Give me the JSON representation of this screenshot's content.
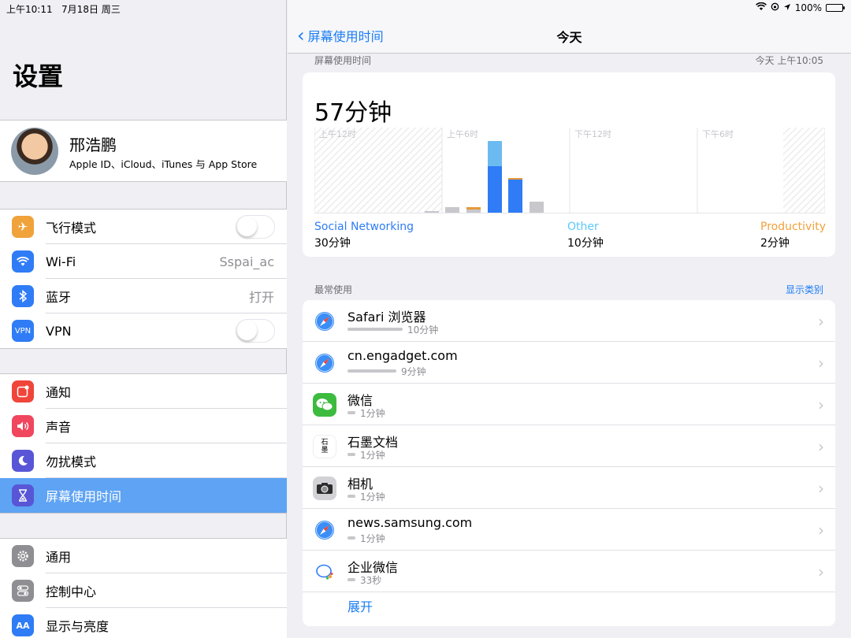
{
  "status_bar": {
    "time": "上午10:11",
    "date": "7月18日 周三",
    "battery": "100%"
  },
  "sidebar": {
    "title": "设置",
    "profile": {
      "name": "邢浩鹏",
      "subtitle": "Apple ID、iCloud、iTunes 与 App Store"
    },
    "group1": [
      {
        "label": "飞行模式",
        "icon": "airplane-icon",
        "color": "#f0a23b",
        "toggle": false
      },
      {
        "label": "Wi-Fi",
        "icon": "wifi-icon",
        "color": "#2f7cf6",
        "value": "Sspai_ac"
      },
      {
        "label": "蓝牙",
        "icon": "bluetooth-icon",
        "color": "#2f7cf6",
        "value": "打开"
      },
      {
        "label": "VPN",
        "icon": "vpn-icon",
        "color": "#2f7cf6",
        "toggle": false
      }
    ],
    "group2": [
      {
        "label": "通知",
        "icon": "notifications-icon",
        "color": "#f0453a"
      },
      {
        "label": "声音",
        "icon": "speaker-icon",
        "color": "#f0465e"
      },
      {
        "label": "勿扰模式",
        "icon": "moon-icon",
        "color": "#5856d6"
      },
      {
        "label": "屏幕使用时间",
        "icon": "hourglass-icon",
        "color": "#5856d6",
        "selected": true
      }
    ],
    "group3": [
      {
        "label": "通用",
        "icon": "gear-icon",
        "color": "#8e8e93"
      },
      {
        "label": "控制中心",
        "icon": "switches-icon",
        "color": "#8e8e93"
      },
      {
        "label": "显示与亮度",
        "icon": "display-icon",
        "color": "#2f7cf6"
      }
    ]
  },
  "nav": {
    "back_label": "屏幕使用时间",
    "title": "今天"
  },
  "screen_time": {
    "header": "屏幕使用时间",
    "updated": "今天 上午10:05",
    "total": "57分钟",
    "chart_ticks": [
      "上午12时",
      "上午6时",
      "下午12时",
      "下午6时"
    ],
    "categories": [
      {
        "name": "Social Networking",
        "time": "30分钟",
        "color": "#2f7cf6"
      },
      {
        "name": "Other",
        "time": "10分钟",
        "color": "#5ac8fa"
      },
      {
        "name": "Productivity",
        "time": "2分钟",
        "color": "#f0a23b"
      }
    ],
    "colors": {
      "social": "#2f7cf6",
      "other": "#6cbbf0",
      "productivity": "#e69a3a",
      "misc": "#c7c7cc"
    }
  },
  "most_used": {
    "header": "最常使用",
    "show_categories": "显示类别",
    "apps": [
      {
        "name": "Safari 浏览器",
        "duration": "10分钟",
        "icon": "safari-icon",
        "fraction": 1.0
      },
      {
        "name": "cn.engadget.com",
        "duration": "9分钟",
        "icon": "safari-icon",
        "fraction": 0.9
      },
      {
        "name": "微信",
        "duration": "1分钟",
        "icon": "wechat-icon",
        "fraction": 0.1
      },
      {
        "name": "石墨文档",
        "duration": "1分钟",
        "icon": "shimo-icon",
        "fraction": 0.1
      },
      {
        "name": "相机",
        "duration": "1分钟",
        "icon": "camera-icon",
        "fraction": 0.1
      },
      {
        "name": "news.samsung.com",
        "duration": "1分钟",
        "icon": "safari-icon",
        "fraction": 0.1
      },
      {
        "name": "企业微信",
        "duration": "33秒",
        "icon": "wework-icon",
        "fraction": 0.06
      }
    ],
    "expand_label": "展开"
  }
}
